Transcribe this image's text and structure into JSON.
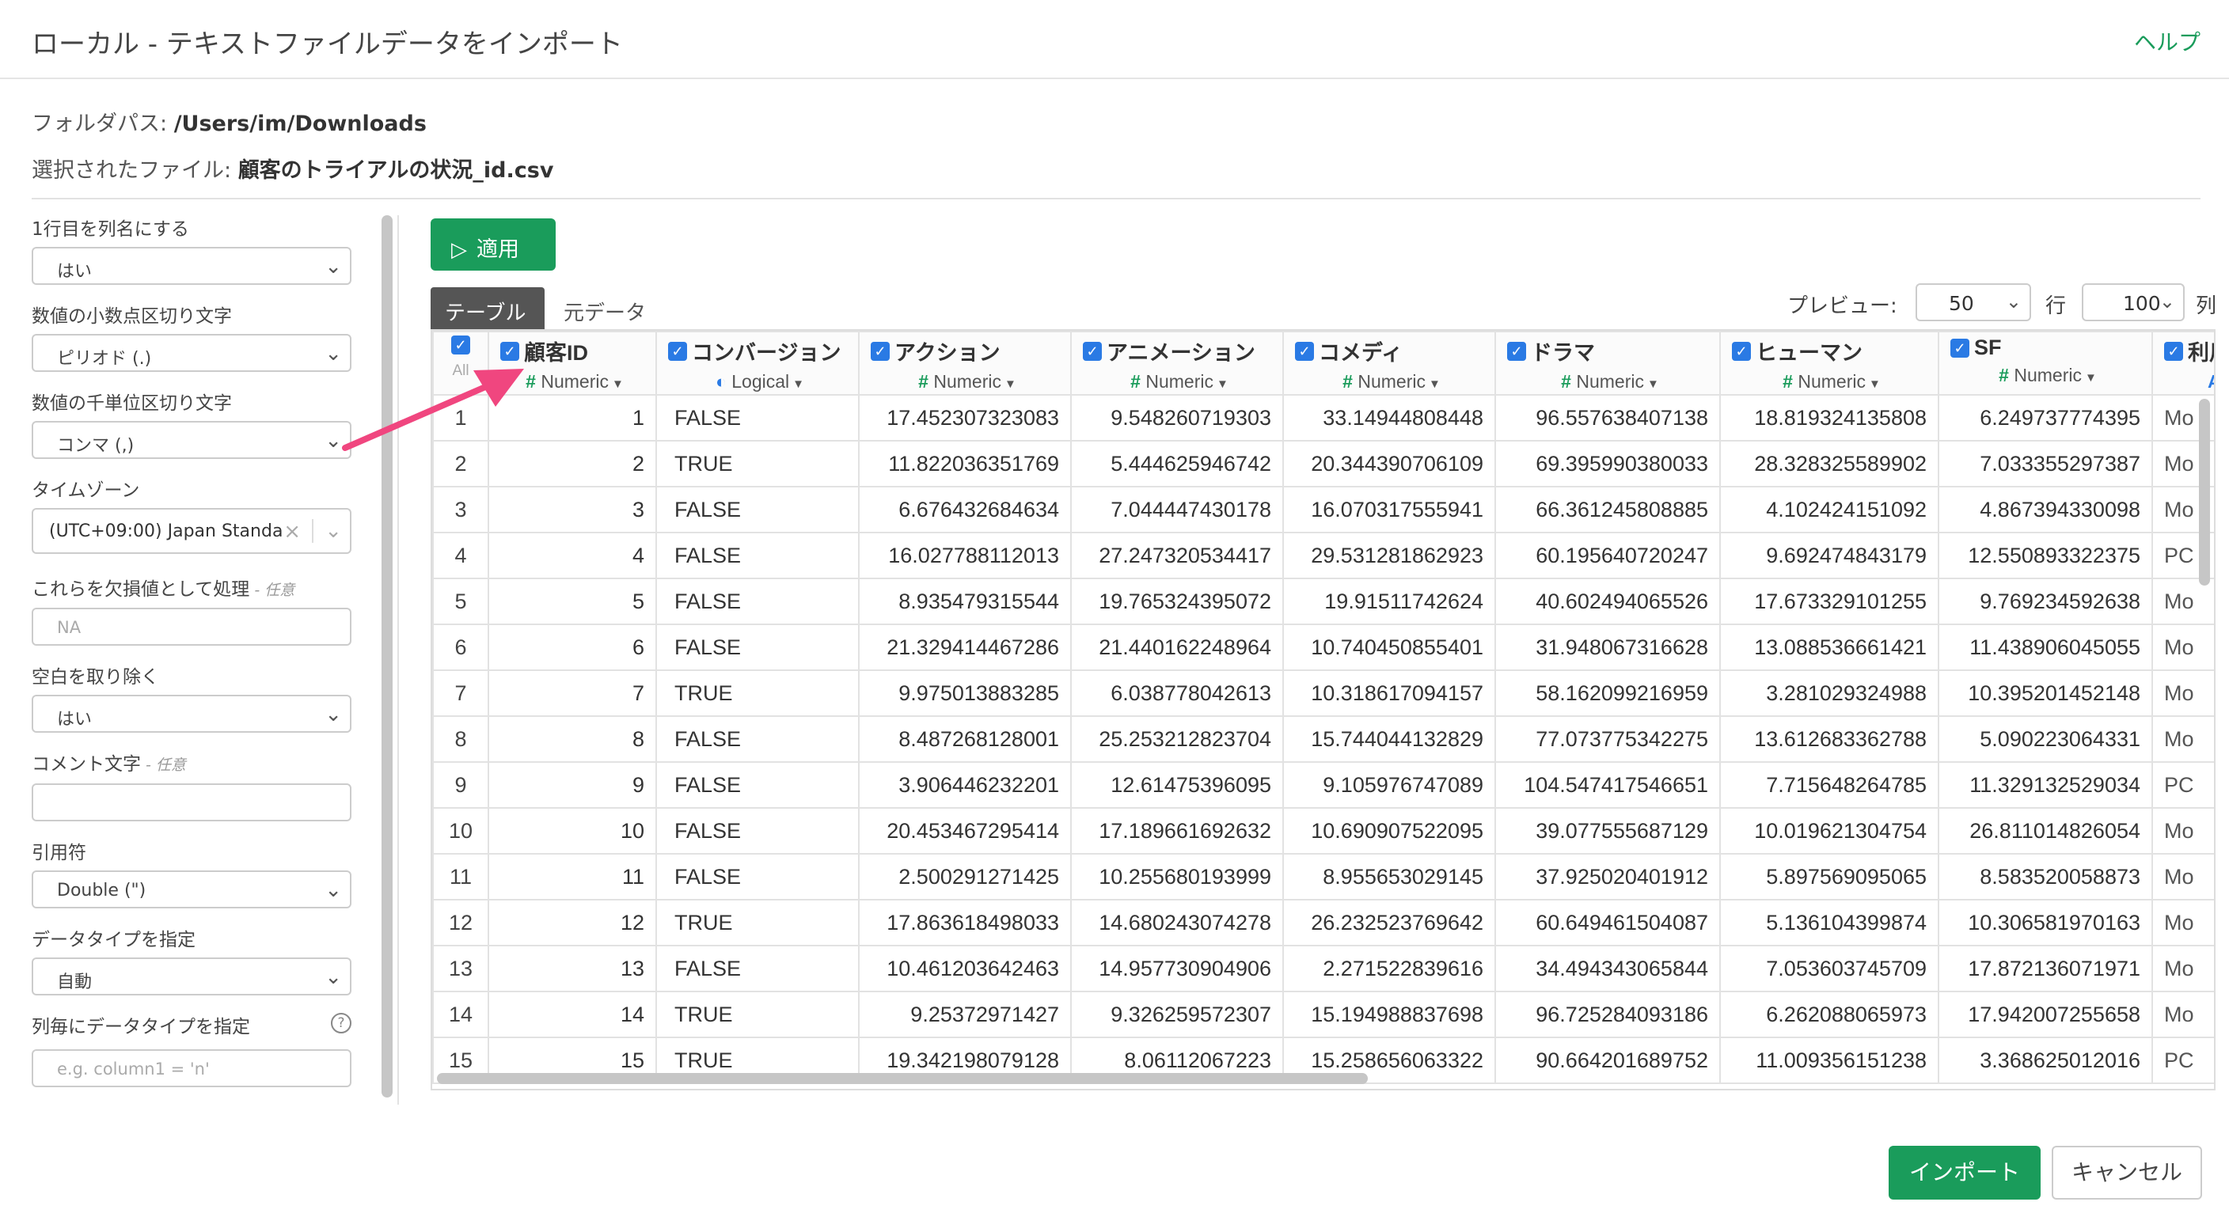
{
  "header": {
    "title": "ローカル - テキストファイルデータをインポート",
    "help": "ヘルプ"
  },
  "info": {
    "folder_label": "フォルダパス: ",
    "folder_value": "/Users/im/Downloads",
    "file_label": "選択されたファイル: ",
    "file_value": "顧客のトライアルの状況_id.csv"
  },
  "settings": {
    "header_row": {
      "label": "1行目を列名にする",
      "value": "はい"
    },
    "decimal": {
      "label": "数値の小数点区切り文字",
      "value": "ピリオド (.)"
    },
    "thousands": {
      "label": "数値の千単位区切り文字",
      "value": "コンマ (,)"
    },
    "timezone": {
      "label": "タイムゾーン",
      "value": "(UTC+09:00) Japan Standa"
    },
    "na": {
      "label": "これらを欠損値として処理",
      "optional": " - 任意",
      "placeholder": "NA"
    },
    "trim": {
      "label": "空白を取り除く",
      "value": "はい"
    },
    "comment": {
      "label": "コメント文字",
      "optional": " - 任意",
      "value": ""
    },
    "quote": {
      "label": "引用符",
      "value": "Double (\")"
    },
    "datatype": {
      "label": "データタイプを指定",
      "value": "自動"
    },
    "col_datatype": {
      "label": "列毎にデータタイプを指定",
      "help": "?",
      "placeholder": "e.g. column1 = 'n'"
    }
  },
  "toolbar": {
    "apply": "適用",
    "tabs": [
      "テーブル",
      "元データ"
    ],
    "preview_label": "プレビュー:",
    "preview_value": "50",
    "rows_label": "行",
    "cols_value": "100",
    "cols_label": "列"
  },
  "grid": {
    "all_label": "All",
    "columns": [
      {
        "name": "顧客ID",
        "type": "Numeric",
        "type_icon": "hash-icon"
      },
      {
        "name": "コンバージョン",
        "type": "Logical",
        "type_icon": "toggle-icon"
      },
      {
        "name": "アクション",
        "type": "Numeric",
        "type_icon": "hash-icon"
      },
      {
        "name": "アニメーション",
        "type": "Numeric",
        "type_icon": "hash-icon"
      },
      {
        "name": "コメディ",
        "type": "Numeric",
        "type_icon": "hash-icon"
      },
      {
        "name": "ドラマ",
        "type": "Numeric",
        "type_icon": "hash-icon"
      },
      {
        "name": "ヒューマン",
        "type": "Numeric",
        "type_icon": "hash-icon"
      },
      {
        "name": "SF",
        "type": "Numeric",
        "type_icon": "hash-icon"
      },
      {
        "name": "利用",
        "type": "Character",
        "type_icon": "text-a-icon"
      }
    ],
    "rows": [
      [
        "1",
        "1",
        "FALSE",
        "17.452307323083",
        "9.548260719303",
        "33.14944808448",
        "96.557638407138",
        "18.819324135808",
        "6.249737774395",
        "Mo"
      ],
      [
        "2",
        "2",
        "TRUE",
        "11.822036351769",
        "5.444625946742",
        "20.344390706109",
        "69.395990380033",
        "28.328325589902",
        "7.033355297387",
        "Mo"
      ],
      [
        "3",
        "3",
        "FALSE",
        "6.676432684634",
        "7.044447430178",
        "16.070317555941",
        "66.361245808885",
        "4.102424151092",
        "4.867394330098",
        "Mo"
      ],
      [
        "4",
        "4",
        "FALSE",
        "16.027788112013",
        "27.247320534417",
        "29.531281862923",
        "60.195640720247",
        "9.692474843179",
        "12.550893322375",
        "PC"
      ],
      [
        "5",
        "5",
        "FALSE",
        "8.935479315544",
        "19.765324395072",
        "19.91511742624",
        "40.602494065526",
        "17.673329101255",
        "9.769234592638",
        "Mo"
      ],
      [
        "6",
        "6",
        "FALSE",
        "21.329414467286",
        "21.440162248964",
        "10.740450855401",
        "31.948067316628",
        "13.088536661421",
        "11.438906045055",
        "Mo"
      ],
      [
        "7",
        "7",
        "TRUE",
        "9.975013883285",
        "6.038778042613",
        "10.318617094157",
        "58.162099216959",
        "3.281029324988",
        "10.395201452148",
        "Mo"
      ],
      [
        "8",
        "8",
        "FALSE",
        "8.487268128001",
        "25.253212823704",
        "15.744044132829",
        "77.073775342275",
        "13.612683362788",
        "5.090223064331",
        "Mo"
      ],
      [
        "9",
        "9",
        "FALSE",
        "3.906446232201",
        "12.61475396095",
        "9.105976747089",
        "104.547417546651",
        "7.715648264785",
        "11.329132529034",
        "PC"
      ],
      [
        "10",
        "10",
        "FALSE",
        "20.453467295414",
        "17.189661692632",
        "10.690907522095",
        "39.077555687129",
        "10.019621304754",
        "26.811014826054",
        "Mo"
      ],
      [
        "11",
        "11",
        "FALSE",
        "2.500291271425",
        "10.255680193999",
        "8.955653029145",
        "37.925020401912",
        "5.897569095065",
        "8.583520058873",
        "Mo"
      ],
      [
        "12",
        "12",
        "TRUE",
        "17.863618498033",
        "14.680243074278",
        "26.232523769642",
        "60.649461504087",
        "5.136104399874",
        "10.306581970163",
        "Mo"
      ],
      [
        "13",
        "13",
        "FALSE",
        "10.461203642463",
        "14.957730904906",
        "2.271522839616",
        "34.494343065844",
        "7.053603745709",
        "17.872136071971",
        "Mo"
      ],
      [
        "14",
        "14",
        "TRUE",
        "9.25372971427",
        "9.326259572307",
        "15.194988837698",
        "96.725284093186",
        "6.262088065973",
        "17.942007255658",
        "Mo"
      ],
      [
        "15",
        "15",
        "TRUE",
        "19.342198079128",
        "8.06112067223",
        "15.258656063322",
        "90.664201689752",
        "11.009356151238",
        "3.368625012016",
        "PC"
      ]
    ]
  },
  "footer": {
    "import": "インポート",
    "cancel": "キャンセル"
  },
  "colors": {
    "accent_green": "#1a9c5b",
    "checkbox_blue": "#2a7ae4",
    "annotation_arrow": "#f0467f"
  }
}
